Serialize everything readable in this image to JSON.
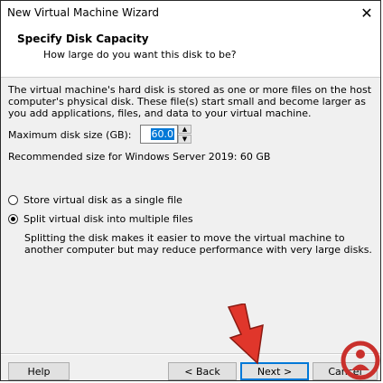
{
  "window": {
    "title": "New Virtual Machine Wizard",
    "close_glyph": "✕"
  },
  "header": {
    "title": "Specify Disk Capacity",
    "subtitle": "How large do you want this disk to be?"
  },
  "body": {
    "description": "The virtual machine's hard disk is stored as one or more files on the host computer's physical disk. These file(s) start small and become larger as you add applications, files, and data to your virtual machine.",
    "max_size_label": "Maximum disk size (GB):",
    "max_size_value": "60.0",
    "recommendation": "Recommended size for Windows Server 2019: 60 GB"
  },
  "options": {
    "single_file": {
      "label": "Store virtual disk as a single file",
      "selected": false
    },
    "multiple_files": {
      "label": "Split virtual disk into multiple files",
      "selected": true
    },
    "split_note": "Splitting the disk makes it easier to move the virtual machine to another computer but may reduce performance with very large disks."
  },
  "footer": {
    "help": "Help",
    "back": "< Back",
    "next": "Next >",
    "cancel": "Cancel"
  },
  "overlay": {
    "arrow_color": "#e0362b",
    "logo_color": "#c9302c",
    "logo_icon": "solvetic-logo"
  }
}
